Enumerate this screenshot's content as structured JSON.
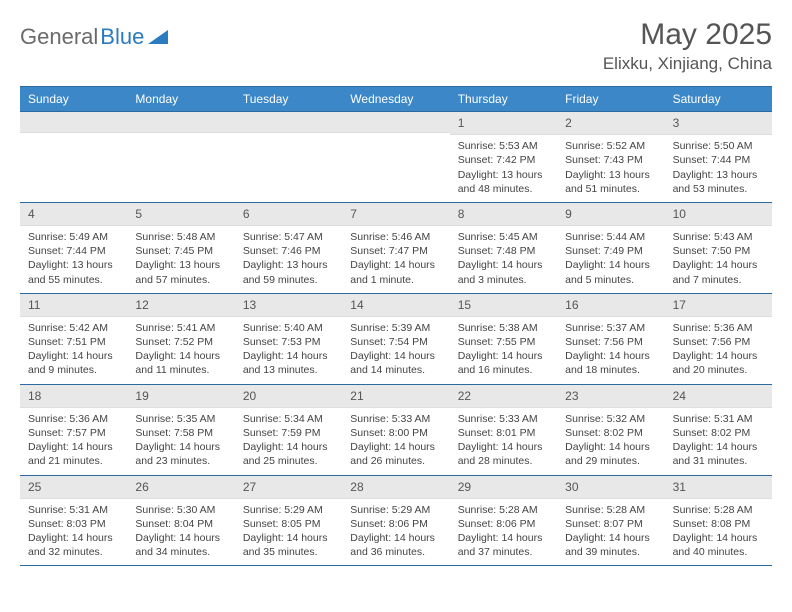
{
  "logo": {
    "part1": "General",
    "part2": "Blue"
  },
  "title": "May 2025",
  "location": "Elixku, Xinjiang, China",
  "dayHeaders": [
    "Sunday",
    "Monday",
    "Tuesday",
    "Wednesday",
    "Thursday",
    "Friday",
    "Saturday"
  ],
  "weeks": [
    [
      {
        "empty": true
      },
      {
        "empty": true
      },
      {
        "empty": true
      },
      {
        "empty": true
      },
      {
        "num": "1",
        "sunrise": "Sunrise: 5:53 AM",
        "sunset": "Sunset: 7:42 PM",
        "daylight": "Daylight: 13 hours and 48 minutes."
      },
      {
        "num": "2",
        "sunrise": "Sunrise: 5:52 AM",
        "sunset": "Sunset: 7:43 PM",
        "daylight": "Daylight: 13 hours and 51 minutes."
      },
      {
        "num": "3",
        "sunrise": "Sunrise: 5:50 AM",
        "sunset": "Sunset: 7:44 PM",
        "daylight": "Daylight: 13 hours and 53 minutes."
      }
    ],
    [
      {
        "num": "4",
        "sunrise": "Sunrise: 5:49 AM",
        "sunset": "Sunset: 7:44 PM",
        "daylight": "Daylight: 13 hours and 55 minutes."
      },
      {
        "num": "5",
        "sunrise": "Sunrise: 5:48 AM",
        "sunset": "Sunset: 7:45 PM",
        "daylight": "Daylight: 13 hours and 57 minutes."
      },
      {
        "num": "6",
        "sunrise": "Sunrise: 5:47 AM",
        "sunset": "Sunset: 7:46 PM",
        "daylight": "Daylight: 13 hours and 59 minutes."
      },
      {
        "num": "7",
        "sunrise": "Sunrise: 5:46 AM",
        "sunset": "Sunset: 7:47 PM",
        "daylight": "Daylight: 14 hours and 1 minute."
      },
      {
        "num": "8",
        "sunrise": "Sunrise: 5:45 AM",
        "sunset": "Sunset: 7:48 PM",
        "daylight": "Daylight: 14 hours and 3 minutes."
      },
      {
        "num": "9",
        "sunrise": "Sunrise: 5:44 AM",
        "sunset": "Sunset: 7:49 PM",
        "daylight": "Daylight: 14 hours and 5 minutes."
      },
      {
        "num": "10",
        "sunrise": "Sunrise: 5:43 AM",
        "sunset": "Sunset: 7:50 PM",
        "daylight": "Daylight: 14 hours and 7 minutes."
      }
    ],
    [
      {
        "num": "11",
        "sunrise": "Sunrise: 5:42 AM",
        "sunset": "Sunset: 7:51 PM",
        "daylight": "Daylight: 14 hours and 9 minutes."
      },
      {
        "num": "12",
        "sunrise": "Sunrise: 5:41 AM",
        "sunset": "Sunset: 7:52 PM",
        "daylight": "Daylight: 14 hours and 11 minutes."
      },
      {
        "num": "13",
        "sunrise": "Sunrise: 5:40 AM",
        "sunset": "Sunset: 7:53 PM",
        "daylight": "Daylight: 14 hours and 13 minutes."
      },
      {
        "num": "14",
        "sunrise": "Sunrise: 5:39 AM",
        "sunset": "Sunset: 7:54 PM",
        "daylight": "Daylight: 14 hours and 14 minutes."
      },
      {
        "num": "15",
        "sunrise": "Sunrise: 5:38 AM",
        "sunset": "Sunset: 7:55 PM",
        "daylight": "Daylight: 14 hours and 16 minutes."
      },
      {
        "num": "16",
        "sunrise": "Sunrise: 5:37 AM",
        "sunset": "Sunset: 7:56 PM",
        "daylight": "Daylight: 14 hours and 18 minutes."
      },
      {
        "num": "17",
        "sunrise": "Sunrise: 5:36 AM",
        "sunset": "Sunset: 7:56 PM",
        "daylight": "Daylight: 14 hours and 20 minutes."
      }
    ],
    [
      {
        "num": "18",
        "sunrise": "Sunrise: 5:36 AM",
        "sunset": "Sunset: 7:57 PM",
        "daylight": "Daylight: 14 hours and 21 minutes."
      },
      {
        "num": "19",
        "sunrise": "Sunrise: 5:35 AM",
        "sunset": "Sunset: 7:58 PM",
        "daylight": "Daylight: 14 hours and 23 minutes."
      },
      {
        "num": "20",
        "sunrise": "Sunrise: 5:34 AM",
        "sunset": "Sunset: 7:59 PM",
        "daylight": "Daylight: 14 hours and 25 minutes."
      },
      {
        "num": "21",
        "sunrise": "Sunrise: 5:33 AM",
        "sunset": "Sunset: 8:00 PM",
        "daylight": "Daylight: 14 hours and 26 minutes."
      },
      {
        "num": "22",
        "sunrise": "Sunrise: 5:33 AM",
        "sunset": "Sunset: 8:01 PM",
        "daylight": "Daylight: 14 hours and 28 minutes."
      },
      {
        "num": "23",
        "sunrise": "Sunrise: 5:32 AM",
        "sunset": "Sunset: 8:02 PM",
        "daylight": "Daylight: 14 hours and 29 minutes."
      },
      {
        "num": "24",
        "sunrise": "Sunrise: 5:31 AM",
        "sunset": "Sunset: 8:02 PM",
        "daylight": "Daylight: 14 hours and 31 minutes."
      }
    ],
    [
      {
        "num": "25",
        "sunrise": "Sunrise: 5:31 AM",
        "sunset": "Sunset: 8:03 PM",
        "daylight": "Daylight: 14 hours and 32 minutes."
      },
      {
        "num": "26",
        "sunrise": "Sunrise: 5:30 AM",
        "sunset": "Sunset: 8:04 PM",
        "daylight": "Daylight: 14 hours and 34 minutes."
      },
      {
        "num": "27",
        "sunrise": "Sunrise: 5:29 AM",
        "sunset": "Sunset: 8:05 PM",
        "daylight": "Daylight: 14 hours and 35 minutes."
      },
      {
        "num": "28",
        "sunrise": "Sunrise: 5:29 AM",
        "sunset": "Sunset: 8:06 PM",
        "daylight": "Daylight: 14 hours and 36 minutes."
      },
      {
        "num": "29",
        "sunrise": "Sunrise: 5:28 AM",
        "sunset": "Sunset: 8:06 PM",
        "daylight": "Daylight: 14 hours and 37 minutes."
      },
      {
        "num": "30",
        "sunrise": "Sunrise: 5:28 AM",
        "sunset": "Sunset: 8:07 PM",
        "daylight": "Daylight: 14 hours and 39 minutes."
      },
      {
        "num": "31",
        "sunrise": "Sunrise: 5:28 AM",
        "sunset": "Sunset: 8:08 PM",
        "daylight": "Daylight: 14 hours and 40 minutes."
      }
    ]
  ]
}
